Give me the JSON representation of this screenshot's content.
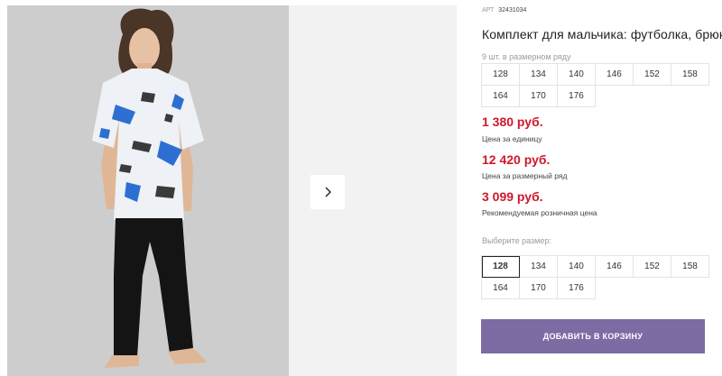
{
  "gallery": {
    "next_icon": "chevron-right-icon"
  },
  "product": {
    "sku_label": "АРТ",
    "sku_value": "32431034",
    "title": "Комплект для мальчика: футболка, брюки"
  },
  "size_run": {
    "label": "9 шт. в размерном ряду",
    "sizes": [
      "128",
      "134",
      "140",
      "146",
      "152",
      "158",
      "164",
      "170",
      "176"
    ]
  },
  "prices": [
    {
      "amount": "1 380 руб.",
      "note": "Цена за единицу"
    },
    {
      "amount": "12 420 руб.",
      "note": "Цена за размерный ряд"
    },
    {
      "amount": "3 099 руб.",
      "note": "Рекомендуемая розничная цена"
    }
  ],
  "size_picker": {
    "label": "Выберите размер:",
    "sizes": [
      "128",
      "134",
      "140",
      "146",
      "152",
      "158",
      "164",
      "170",
      "176"
    ],
    "selected": "128"
  },
  "cart": {
    "button_label": "ДОБАВИТЬ В КОРЗИНУ"
  },
  "colors": {
    "price": "#d0182c",
    "button": "#7d6ba4",
    "photo_bg": "#cdcdcd"
  }
}
